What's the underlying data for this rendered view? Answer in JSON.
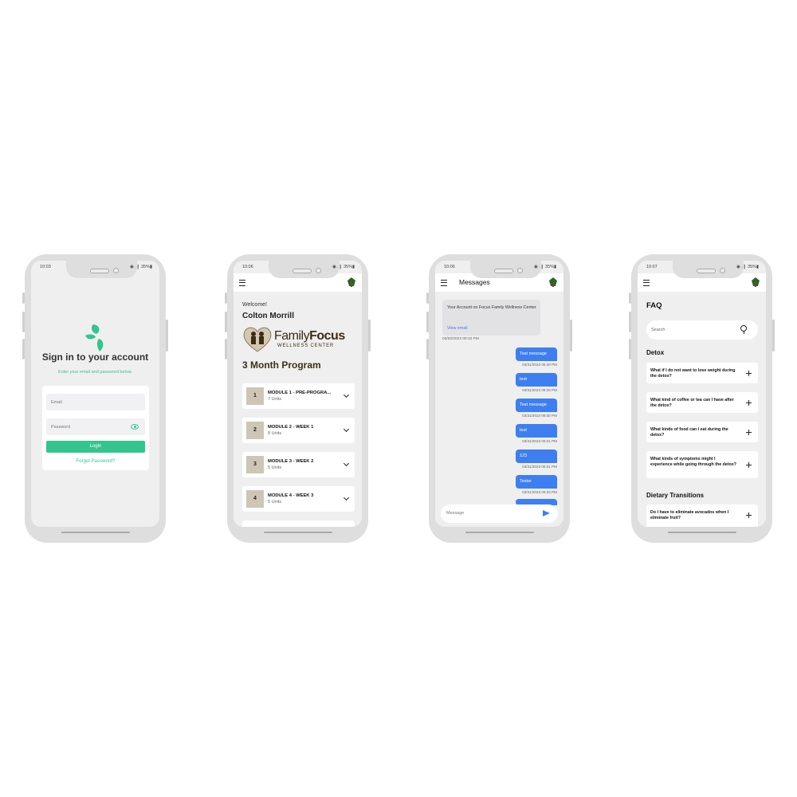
{
  "phone1": {
    "status": {
      "time": "10:03",
      "right": "◉ .❙ 35%▮"
    },
    "title": "Sign in to your account",
    "subtitle": "Enter your email and password below.",
    "email_placeholder": "Email",
    "password_placeholder": "Password",
    "login_label": "Login",
    "forgot_label": "Forgot Password?",
    "accent": "#34c48f"
  },
  "phone2": {
    "status": {
      "time": "10:06",
      "right": "◉ .❙ 35%▮"
    },
    "welcome": "Welcome!",
    "user_name": "Colton Morrill",
    "brand": {
      "family": "Family",
      "focus": "Focus",
      "sub": "WELLNESS CENTER"
    },
    "program_title": "3 Month Program",
    "modules": [
      {
        "num": "1",
        "title": "MODULE 1 - PRE-PROGRA...",
        "units": "7 Units"
      },
      {
        "num": "2",
        "title": "MODULE 2 - WEEK 1",
        "units": "8 Units"
      },
      {
        "num": "3",
        "title": "MODULE 3 - WEEK 2",
        "units": "5 Units"
      },
      {
        "num": "4",
        "title": "MODULE 4 - WEEK 3",
        "units": "5 Units"
      }
    ]
  },
  "phone3": {
    "status": {
      "time": "10:06",
      "right": "◉ .❙ 35%▮"
    },
    "title": "Messages",
    "email_notice": "Your Account on Focus Family Wellness Center",
    "view_email": "View email",
    "email_time": "03/20/2023 09:10 PM",
    "messages": [
      {
        "text": "Test message",
        "time": "03/31/2023 05:49 PM"
      },
      {
        "text": "test",
        "time": "03/31/2023 09:26 PM"
      },
      {
        "text": "Test message",
        "time": "03/31/2023 09:30 PM"
      },
      {
        "text": "test",
        "time": "03/31/2023 09:31 PM"
      },
      {
        "text": "123",
        "time": "03/31/2023 09:31 PM"
      },
      {
        "text": "Tester",
        "time": "03/31/2023 09:33 PM"
      }
    ],
    "input_placeholder": "Message",
    "accent": "#3d7ff0"
  },
  "phone4": {
    "status": {
      "time": "10:07",
      "right": "◉ .❙ 35%▮"
    },
    "title": "FAQ",
    "search_placeholder": "Search",
    "sections": [
      {
        "name": "Detox",
        "questions": [
          "What if I do not want to lose weight during the detox?",
          "What kind of coffee or tea can I have after the detox?",
          "What kinds of food can I eat during the detox?",
          "What kinds of symptoms might I experience while going through the detox?"
        ]
      },
      {
        "name": "Dietary Transitions",
        "questions": [
          "Do I have to eliminate avocados when I eliminate fruit?"
        ]
      }
    ]
  }
}
